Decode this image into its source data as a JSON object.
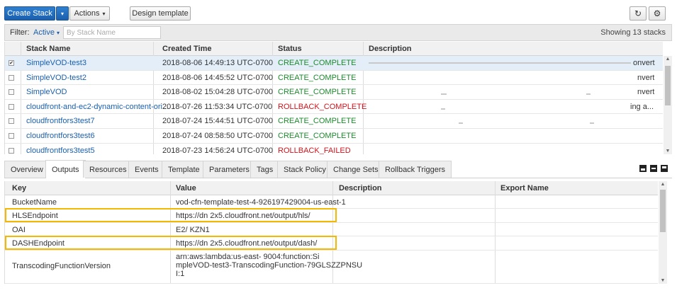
{
  "toolbar": {
    "create_stack": "Create Stack",
    "actions": "Actions",
    "design_template": "Design template",
    "refresh_icon": "refresh-icon",
    "settings_icon": "gear-icon"
  },
  "filter": {
    "label": "Filter:",
    "active_value": "Active",
    "placeholder": "By Stack Name",
    "showing": "Showing 13 stacks"
  },
  "stacks": {
    "headers": [
      "Stack Name",
      "Created Time",
      "Status",
      "Description"
    ],
    "rows": [
      {
        "name": "SimpleVOD-test3",
        "created": "2018-08-06 14:49:13 UTC-0700",
        "status": "CREATE_COMPLETE",
        "desc": "onvert",
        "selected": true
      },
      {
        "name": "SimpleVOD-test2",
        "created": "2018-08-06 14:45:52 UTC-0700",
        "status": "CREATE_COMPLETE",
        "desc": "nvert",
        "selected": false
      },
      {
        "name": "SimpleVOD",
        "created": "2018-08-02 15:04:28 UTC-0700",
        "status": "CREATE_COMPLETE",
        "desc": "nvert",
        "selected": false
      },
      {
        "name": "cloudfront-and-ec2-dynamic-content-ori...",
        "created": "2018-07-26 11:53:34 UTC-0700",
        "status": "ROLLBACK_COMPLETE",
        "desc": "ing a...",
        "selected": false
      },
      {
        "name": "cloudfrontfors3test7",
        "created": "2018-07-24 15:44:51 UTC-0700",
        "status": "CREATE_COMPLETE",
        "desc": "",
        "selected": false
      },
      {
        "name": "cloudfrontfors3test6",
        "created": "2018-07-24 08:58:50 UTC-0700",
        "status": "CREATE_COMPLETE",
        "desc": "",
        "selected": false
      },
      {
        "name": "cloudfrontfors3test5",
        "created": "2018-07-23 14:56:24 UTC-0700",
        "status": "ROLLBACK_FAILED",
        "desc": "",
        "selected": false
      }
    ]
  },
  "tabs": [
    "Overview",
    "Outputs",
    "Resources",
    "Events",
    "Template",
    "Parameters",
    "Tags",
    "Stack Policy",
    "Change Sets",
    "Rollback Triggers"
  ],
  "active_tab": "Outputs",
  "outputs": {
    "headers": [
      "Key",
      "Value",
      "Description",
      "Export Name"
    ],
    "rows": [
      {
        "key": "BucketName",
        "value": "vod-cfn-template-test-4-926197429004-us-east-1",
        "link": false
      },
      {
        "key": "HLSEndpoint",
        "value": "https://dn              2x5.cloudfront.net/output/hls/",
        "link": true
      },
      {
        "key": "OAI",
        "value": "E2/             KZN1",
        "link": false
      },
      {
        "key": "DASHEndpoint",
        "value": "https://dn              2x5.cloudfront.net/output/dash/",
        "link": true
      },
      {
        "key": "TranscodingFunctionVersion",
        "value_lines": [
          "arn:aws:lambda:us-east-          9004:function:Si",
          "mpleVOD-test3-TranscodingFunction-79GLSZZPNSU",
          "I:1"
        ],
        "link": false
      }
    ]
  },
  "colors": {
    "primary": "#1a5fae",
    "ok": "#1c8a2c",
    "fail": "#d0131c",
    "highlight": "#f5b800",
    "selected_row": "#e3eef9"
  }
}
